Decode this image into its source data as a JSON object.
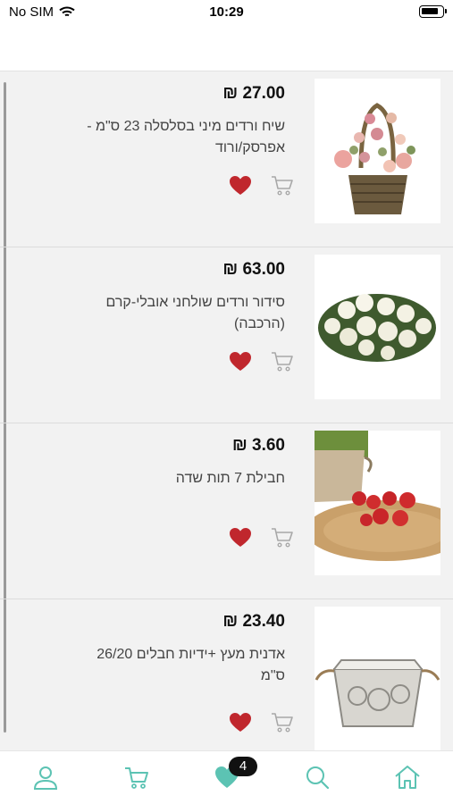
{
  "status_bar": {
    "carrier": "No SIM",
    "time": "10:29"
  },
  "products": [
    {
      "price": "27.00 ₪",
      "title": "שיח ורדים מיני בסלסלה 23 ס\"מ - אפרסק/ורוד"
    },
    {
      "price": "63.00 ₪",
      "title": "סידור ורדים שולחני אובלי-קרם (הרכבה)"
    },
    {
      "price": "3.60 ₪",
      "title": "חבילת 7 תות שדה"
    },
    {
      "price": "23.40 ₪",
      "title": "אדנית מעץ +ידיות חבלים 26/20 ס\"מ"
    }
  ],
  "tab_bar": {
    "favorites_badge": "4"
  },
  "colors": {
    "accent": "#5cc3b3",
    "heart": "#c0272d",
    "cart_icon": "#a8a8a8"
  },
  "icons": [
    "wifi-icon",
    "battery-icon",
    "heart-icon",
    "cart-icon",
    "user-icon",
    "search-icon",
    "home-icon"
  ]
}
